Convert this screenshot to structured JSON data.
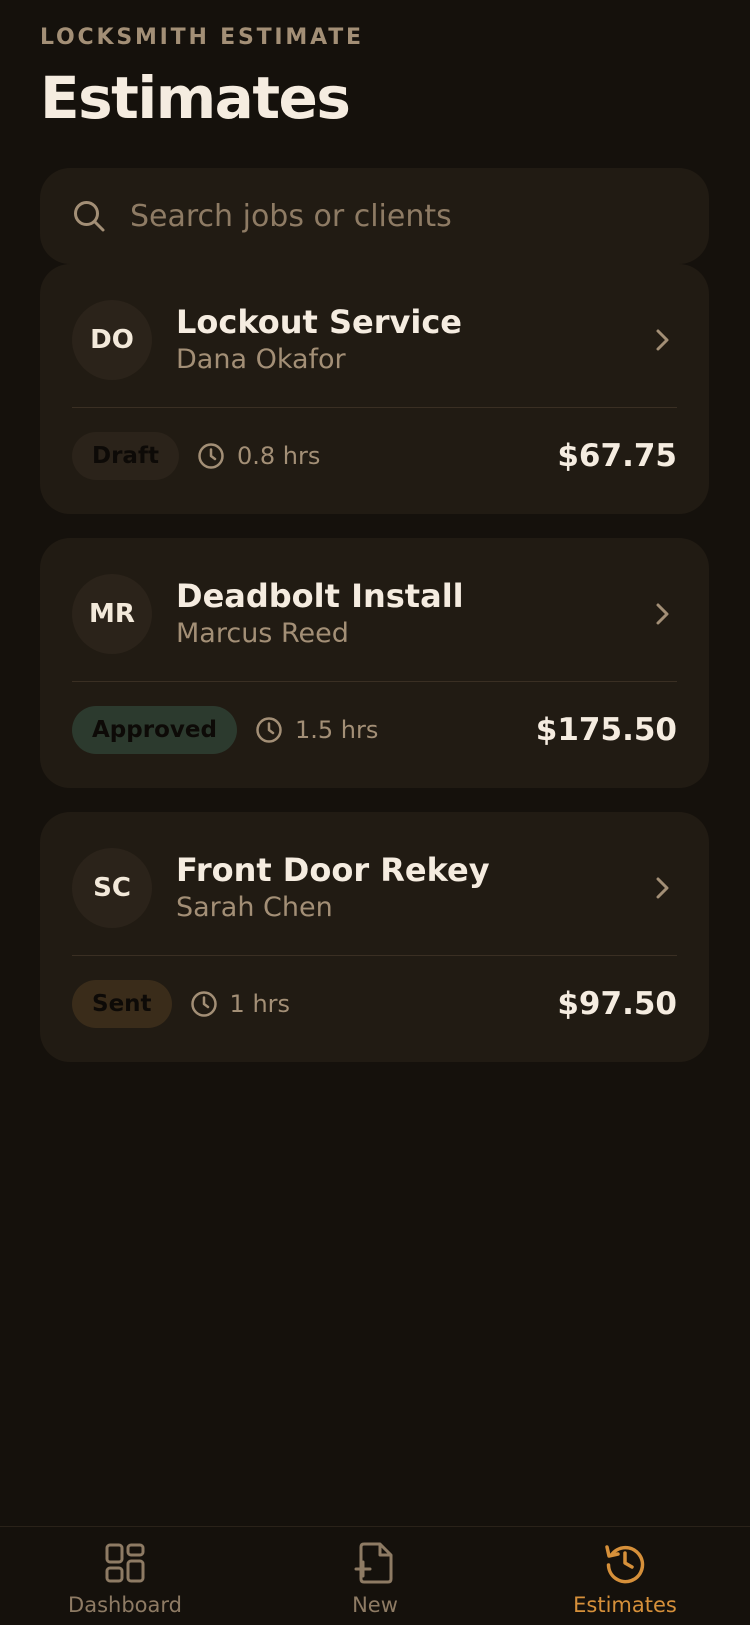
{
  "header": {
    "eyebrow": "LOCKSMITH ESTIMATE",
    "title": "Estimates"
  },
  "search": {
    "placeholder": "Search jobs or clients",
    "value": ""
  },
  "estimates": [
    {
      "initials": "DO",
      "title": "Lockout Service",
      "client": "Dana Okafor",
      "status": "Draft",
      "hours": "0.8 hrs",
      "price": "$67.75"
    },
    {
      "initials": "MR",
      "title": "Deadbolt Install",
      "client": "Marcus Reed",
      "status": "Approved",
      "hours": "1.5 hrs",
      "price": "$175.50"
    },
    {
      "initials": "SC",
      "title": "Front Door Rekey",
      "client": "Sarah Chen",
      "status": "Sent",
      "hours": "1 hrs",
      "price": "$97.50"
    }
  ],
  "tabs": [
    {
      "label": "Dashboard",
      "icon": "grid-icon",
      "active": false
    },
    {
      "label": "New",
      "icon": "new-document-icon",
      "active": false
    },
    {
      "label": "Estimates",
      "icon": "history-icon",
      "active": true
    }
  ],
  "colors": {
    "background": "#15110c",
    "card": "#211b13",
    "accent": "#d6903a",
    "muted_text": "#a38f76",
    "badge_draft": "#2b231a",
    "badge_approved": "#2c3a2e",
    "badge_sent": "#3a2c1a"
  }
}
